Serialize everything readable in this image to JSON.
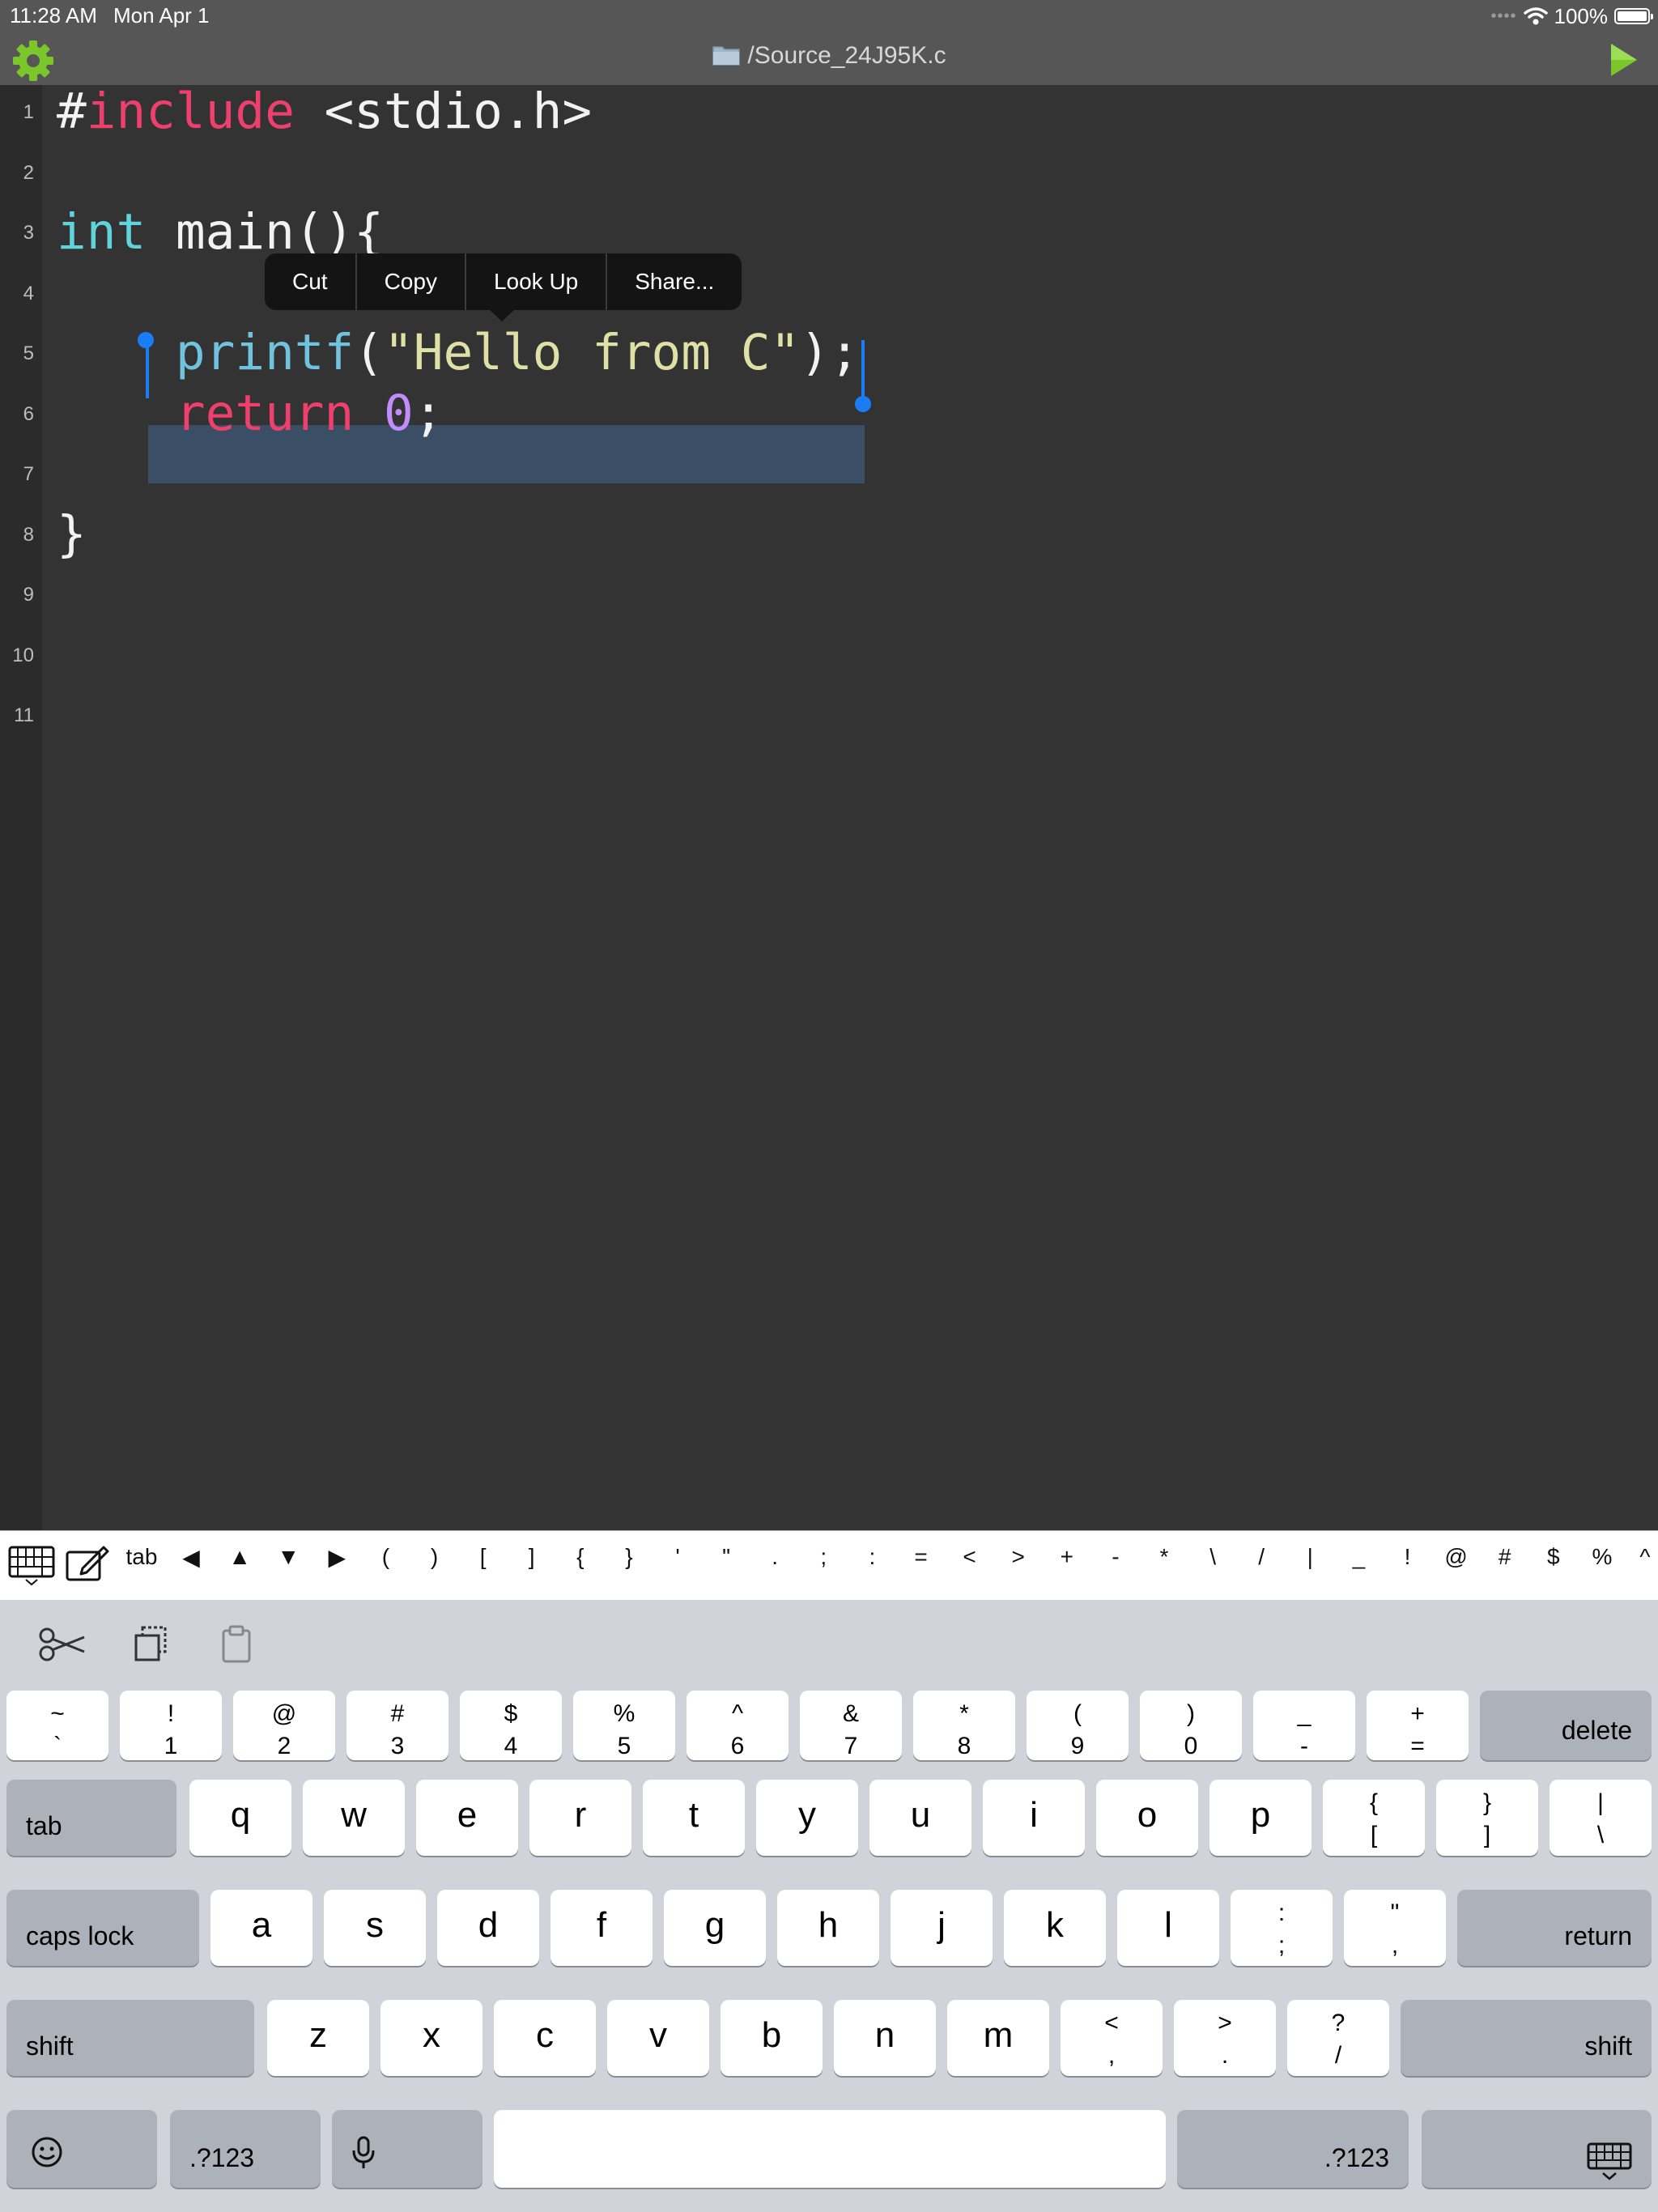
{
  "status_bar": {
    "time": "11:28 AM",
    "date": "Mon Apr 1",
    "battery": "100%"
  },
  "titlebar": {
    "filename": "/Source_24J95K.c",
    "settings_icon": "gear-icon",
    "run_icon": "play-icon",
    "accent_green": "#7bc62b"
  },
  "editor": {
    "line_numbers": [
      "1",
      "2",
      "3",
      "4",
      "5",
      "6",
      "7",
      "8",
      "9",
      "10",
      "11"
    ],
    "lines": [
      {
        "tokens": [
          [
            "#",
            "hash"
          ],
          [
            "include",
            "kw"
          ],
          [
            " <stdio.h>",
            "plain"
          ]
        ]
      },
      {
        "tokens": []
      },
      {
        "tokens": [
          [
            "int",
            "type"
          ],
          [
            " main(){",
            "plain"
          ]
        ]
      },
      {
        "tokens": []
      },
      {
        "tokens": [
          [
            "    ",
            "plain"
          ],
          [
            "printf",
            "fn"
          ],
          [
            "(",
            "plain"
          ],
          [
            "\"Hello from C\"",
            "str"
          ],
          [
            ");",
            "plain"
          ]
        ]
      },
      {
        "tokens": [
          [
            "    ",
            "plain"
          ],
          [
            "return",
            "kw"
          ],
          [
            " ",
            "plain"
          ],
          [
            "0",
            "num"
          ],
          [
            ";",
            "plain"
          ]
        ]
      },
      {
        "tokens": []
      },
      {
        "tokens": [
          [
            "}",
            "plain"
          ]
        ]
      },
      {
        "tokens": []
      },
      {
        "tokens": []
      },
      {
        "tokens": []
      }
    ],
    "selected_text": "printf(\"Hello from C\");",
    "colors": {
      "background": "#333333",
      "keyword": "#ef3f6d",
      "type": "#61d3db",
      "string": "#dfe0a5",
      "number": "#c28cff",
      "selection": "#3a4f66",
      "caret": "#1a7df5"
    }
  },
  "context_menu": {
    "items": [
      "Cut",
      "Copy",
      "Look Up",
      "Share..."
    ]
  },
  "accessory_bar": {
    "keyboard_toggle_icon": "keyboard-icon",
    "edit_icon": "compose-icon",
    "keys": [
      "tab",
      "◀",
      "▲",
      "▼",
      "▶",
      "(",
      ")",
      "[",
      "]",
      "{",
      "}",
      "'",
      "\"",
      ".",
      ";",
      ":",
      "=",
      "<",
      ">",
      "+",
      "-",
      "*",
      "\\",
      "/",
      "|",
      "_",
      "!",
      "@",
      "#",
      "$",
      "%",
      "^"
    ]
  },
  "keyboard": {
    "shortcuts": [
      "scissors-icon",
      "copy-icon",
      "paste-icon"
    ],
    "number_row": [
      {
        "top": "~",
        "bottom": "`"
      },
      {
        "top": "!",
        "bottom": "1"
      },
      {
        "top": "@",
        "bottom": "2"
      },
      {
        "top": "#",
        "bottom": "3"
      },
      {
        "top": "$",
        "bottom": "4"
      },
      {
        "top": "%",
        "bottom": "5"
      },
      {
        "top": "^",
        "bottom": "6"
      },
      {
        "top": "&",
        "bottom": "7"
      },
      {
        "top": "*",
        "bottom": "8"
      },
      {
        "top": "(",
        "bottom": "9"
      },
      {
        "top": ")",
        "bottom": "0"
      },
      {
        "top": "_",
        "bottom": "-"
      },
      {
        "top": "+",
        "bottom": "="
      }
    ],
    "delete_label": "delete",
    "tab_label": "tab",
    "row_q": [
      "q",
      "w",
      "e",
      "r",
      "t",
      "y",
      "u",
      "i",
      "o",
      "p"
    ],
    "row_q_symbols": [
      {
        "top": "{",
        "bottom": "["
      },
      {
        "top": "}",
        "bottom": "]"
      },
      {
        "top": "|",
        "bottom": "\\"
      }
    ],
    "caps_lock_label": "caps lock",
    "row_a": [
      "a",
      "s",
      "d",
      "f",
      "g",
      "h",
      "j",
      "k",
      "l"
    ],
    "row_a_symbols": [
      {
        "top": ":",
        "bottom": ";"
      },
      {
        "top": "\"",
        "bottom": ","
      }
    ],
    "return_label": "return",
    "shift_label": "shift",
    "row_z": [
      "z",
      "x",
      "c",
      "v",
      "b",
      "n",
      "m"
    ],
    "row_z_symbols": [
      {
        "top": "<",
        "bottom": ","
      },
      {
        "top": ">",
        "bottom": "."
      },
      {
        "top": "?",
        "bottom": "/"
      }
    ],
    "numbers_label": ".?123",
    "emoji_icon": "emoji-icon",
    "mic_icon": "microphone-icon",
    "dismiss_icon": "keyboard-dismiss-icon"
  }
}
